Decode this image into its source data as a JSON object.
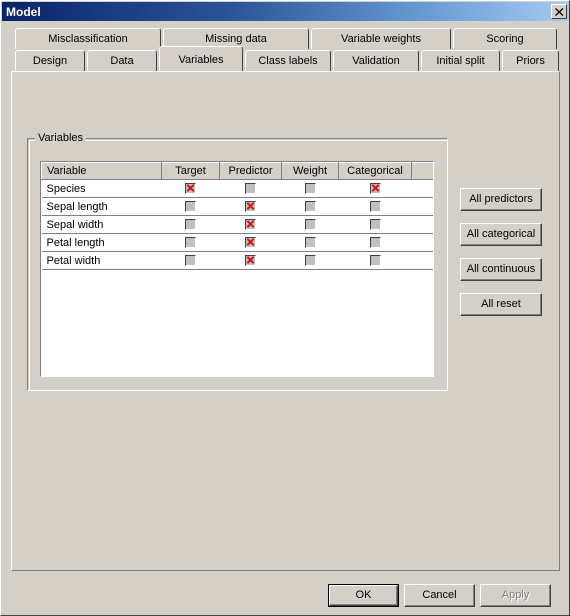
{
  "window": {
    "title": "Model",
    "close_icon": "close-icon"
  },
  "tabs": {
    "row1": [
      {
        "label": "Misclassification",
        "selected": false
      },
      {
        "label": "Missing data",
        "selected": false
      },
      {
        "label": "Variable weights",
        "selected": false
      },
      {
        "label": "Scoring",
        "selected": false
      }
    ],
    "row2": [
      {
        "label": "Design",
        "selected": false
      },
      {
        "label": "Data",
        "selected": false
      },
      {
        "label": "Variables",
        "selected": true
      },
      {
        "label": "Class labels",
        "selected": false
      },
      {
        "label": "Validation",
        "selected": false
      },
      {
        "label": "Initial split",
        "selected": false
      },
      {
        "label": "Priors",
        "selected": false
      }
    ]
  },
  "group": {
    "legend": "Variables"
  },
  "table": {
    "columns": [
      "Variable",
      "Target",
      "Predictor",
      "Weight",
      "Categorical",
      ""
    ],
    "rows": [
      {
        "variable": "Species",
        "target": true,
        "predictor": false,
        "weight": false,
        "categorical": true
      },
      {
        "variable": "Sepal length",
        "target": false,
        "predictor": true,
        "weight": false,
        "categorical": false
      },
      {
        "variable": "Sepal width",
        "target": false,
        "predictor": true,
        "weight": false,
        "categorical": false
      },
      {
        "variable": "Petal length",
        "target": false,
        "predictor": true,
        "weight": false,
        "categorical": false
      },
      {
        "variable": "Petal width",
        "target": false,
        "predictor": true,
        "weight": false,
        "categorical": false
      }
    ]
  },
  "side_buttons": {
    "all_predictors": "All predictors",
    "all_categorical": "All categorical",
    "all_continuous": "All continuous",
    "all_reset": "All reset"
  },
  "footer": {
    "ok": "OK",
    "cancel": "Cancel",
    "apply": "Apply",
    "apply_enabled": false
  },
  "colors": {
    "check_red": "#d81010",
    "face": "#d4d0c8",
    "title_left": "#0a246a",
    "title_right": "#a6caf0"
  }
}
